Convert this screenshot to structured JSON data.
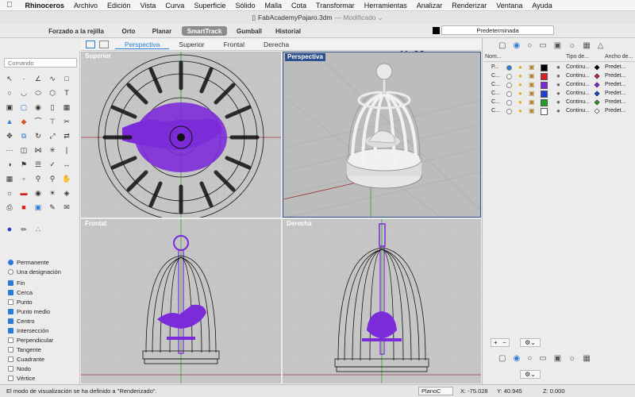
{
  "app": {
    "name": "Rhinoceros",
    "file_title": "FabAcademyPajaro.3dm",
    "modified": "— Modificado"
  },
  "menu": [
    "Archivo",
    "Edición",
    "Vista",
    "Curva",
    "Superficie",
    "Sólido",
    "Malla",
    "Cota",
    "Transformar",
    "Herramientas",
    "Analizar",
    "Renderizar",
    "Ventana",
    "Ayuda"
  ],
  "toolbar": {
    "grid_snap": "Forzado a la rejilla",
    "ortho": "Orto",
    "planar": "Planar",
    "smarttrack": "SmartTrack",
    "gumball": "Gumball",
    "history": "Historial",
    "layer": "Predeterminada"
  },
  "viewtabs": [
    "Perspectiva",
    "Superior",
    "Frontal",
    "Derecha"
  ],
  "command_placeholder": "Comando",
  "osnap": {
    "mode": [
      {
        "label": "Permanente",
        "on": true
      },
      {
        "label": "Una designación",
        "on": false
      }
    ],
    "items": [
      {
        "label": "Fin",
        "on": true
      },
      {
        "label": "Cerca",
        "on": true
      },
      {
        "label": "Punto",
        "on": false
      },
      {
        "label": "Punto medio",
        "on": true
      },
      {
        "label": "Centro",
        "on": true
      },
      {
        "label": "Intersección",
        "on": true
      },
      {
        "label": "Perpendicular",
        "on": false
      },
      {
        "label": "Tangente",
        "on": false
      },
      {
        "label": "Cuadrante",
        "on": false
      },
      {
        "label": "Nodo",
        "on": false
      },
      {
        "label": "Vértice",
        "on": false
      }
    ]
  },
  "viewports": {
    "top": "Superior",
    "perspective": "Perspectiva",
    "front": "Frontal",
    "right": "Derecha"
  },
  "layers": {
    "headers": [
      "Nom...",
      "Tipo de...",
      "Ancho de..."
    ],
    "rows": [
      {
        "name": "P...",
        "current": true,
        "color": "#000000",
        "mat": "Predet..."
      },
      {
        "name": "C...",
        "current": false,
        "color": "#d42020",
        "mat": "Predet..."
      },
      {
        "name": "C...",
        "current": false,
        "color": "#7c2bd8",
        "mat": "Predet..."
      },
      {
        "name": "C...",
        "current": false,
        "color": "#1f3fd4",
        "mat": "Predet..."
      },
      {
        "name": "C...",
        "current": false,
        "color": "#1fa02a",
        "mat": "Predet..."
      },
      {
        "name": "C...",
        "current": false,
        "color": "#ffffff",
        "mat": "Predet..."
      }
    ]
  },
  "status": {
    "message": "El modo de visualización se ha definido a \"Renderizado\".",
    "plane": "PlanoC",
    "x": "X: -75.028",
    "y": "Y: 40.945",
    "z": "Z: 0.000"
  }
}
